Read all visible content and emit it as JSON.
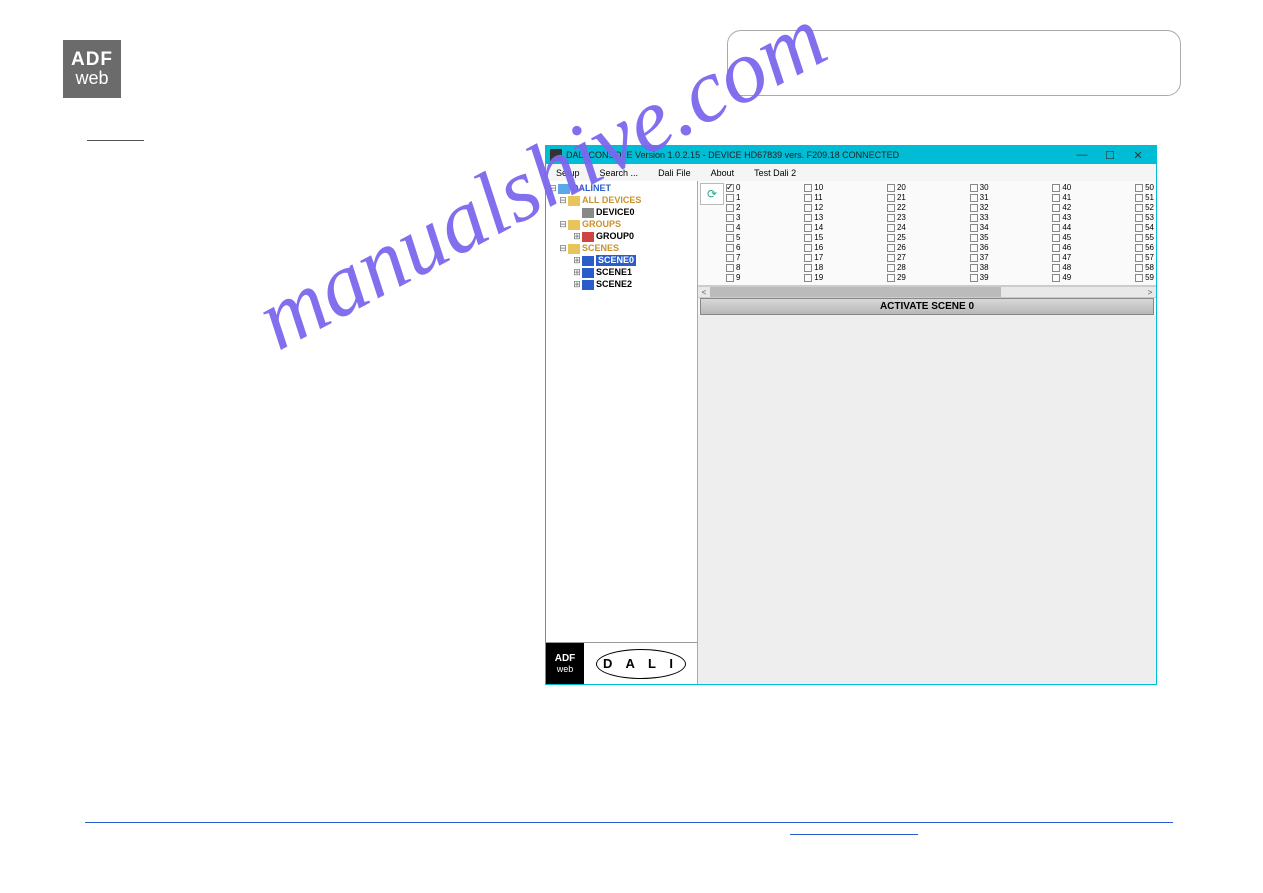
{
  "logo": {
    "line1": "ADF",
    "line2": "web"
  },
  "watermark": "manualshive.com",
  "appwindow": {
    "title": "DALI CONSOLE Version 1.0.2.15 - DEVICE HD67839    vers. F209.18 CONNECTED",
    "winbtns": {
      "min": "—",
      "max": "☐",
      "close": "✕"
    },
    "menu": [
      "Setup",
      "Search ...",
      "Dali File",
      "About",
      "Test Dali 2"
    ],
    "tree": {
      "root": "DALINET",
      "all_devices": "ALL DEVICES",
      "device0": "DEVICE0",
      "groups": "GROUPS",
      "group0": "GROUP0",
      "scenes": "SCENES",
      "scene0": "SCENE0",
      "scene1": "SCENE1",
      "scene2": "SCENE2"
    },
    "checkboxes": {
      "cols": [
        [
          "0",
          "1",
          "2",
          "3",
          "4",
          "5",
          "6",
          "7",
          "8",
          "9"
        ],
        [
          "10",
          "11",
          "12",
          "13",
          "14",
          "15",
          "16",
          "17",
          "18",
          "19"
        ],
        [
          "20",
          "21",
          "22",
          "23",
          "24",
          "25",
          "26",
          "27",
          "28",
          "29"
        ],
        [
          "30",
          "31",
          "32",
          "33",
          "34",
          "35",
          "36",
          "37",
          "38",
          "39"
        ],
        [
          "40",
          "41",
          "42",
          "43",
          "44",
          "45",
          "46",
          "47",
          "48",
          "49"
        ],
        [
          "50",
          "51",
          "52",
          "53",
          "54",
          "55",
          "56",
          "57",
          "58",
          "59"
        ]
      ],
      "checked": [
        "0"
      ]
    },
    "activate_label": "ACTIVATE SCENE 0",
    "refresh_icon": "⟳",
    "dali_logo": "D A L I",
    "mini_logo": {
      "l1": "ADF",
      "l2": "web"
    },
    "scroll": {
      "left": "<",
      "right": ">"
    }
  }
}
